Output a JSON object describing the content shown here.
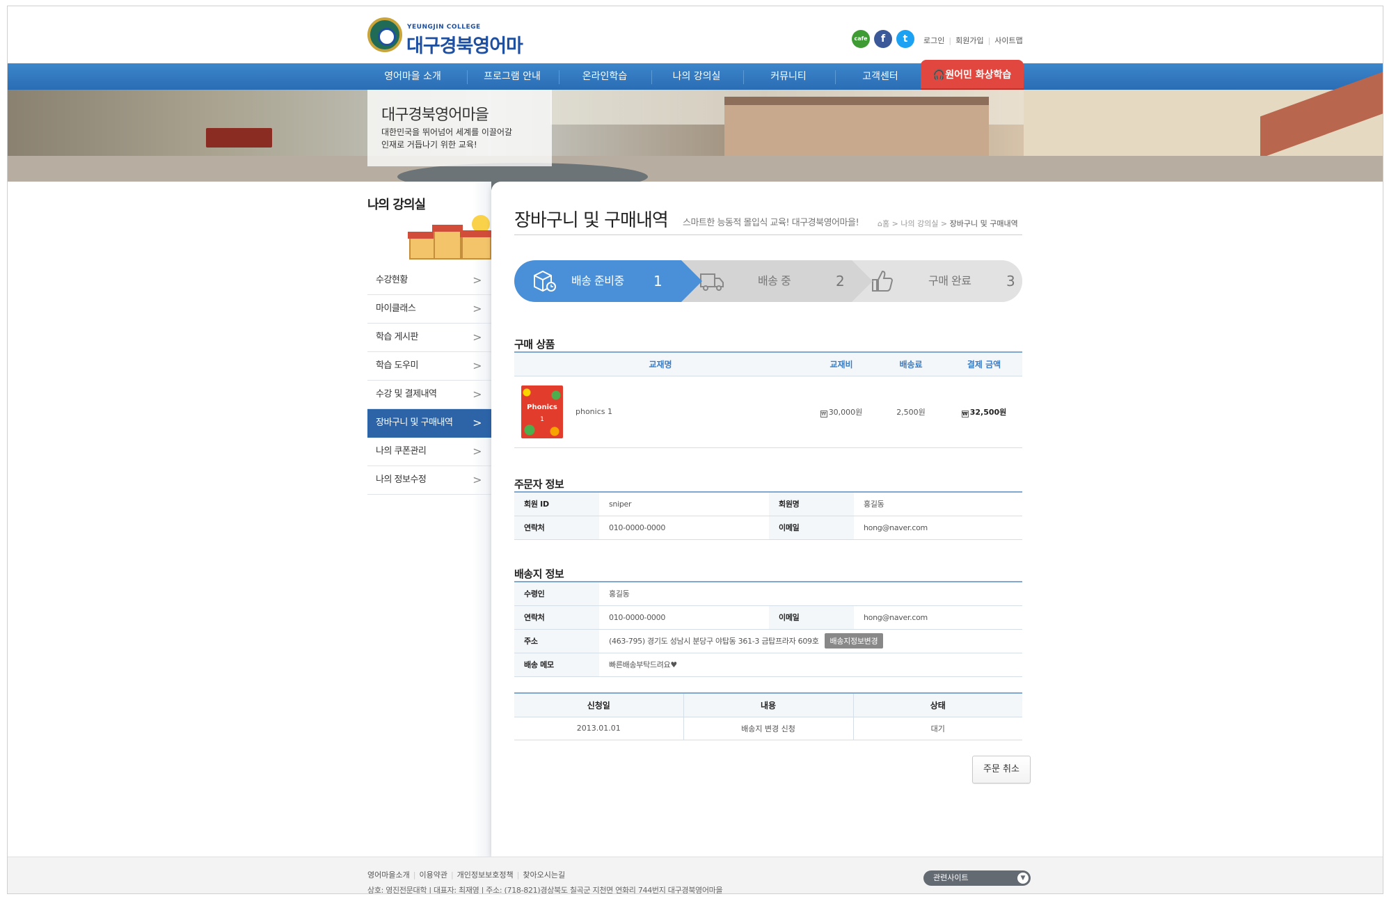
{
  "header": {
    "logo_sub": "YEUNGJIN COLLEGE",
    "logo_main": "대구경북영어마을",
    "social": {
      "cafe": "cafe",
      "facebook": "f",
      "twitter": "t"
    },
    "util_links": [
      "로그인",
      "회원가입",
      "사이트맵"
    ]
  },
  "nav": {
    "items": [
      "영어마을 소개",
      "프로그램 안내",
      "온라인학습",
      "나의 강의실",
      "커뮤니티",
      "고객센터"
    ],
    "special": "원어민 화상학습"
  },
  "banner": {
    "title": "대구경북영어마을",
    "desc_line1": "대한민국을 뛰어넘어 세계를 이끌어갈",
    "desc_line2": "인재로 거듭나기 위한 교육!"
  },
  "sidebar": {
    "title": "나의 강의실",
    "items": [
      {
        "label": "수강현황"
      },
      {
        "label": "마이클래스"
      },
      {
        "label": "학습 게시판"
      },
      {
        "label": "학습 도우미"
      },
      {
        "label": "수강 및 결제내역"
      },
      {
        "label": "장바구니 및 구매내역"
      },
      {
        "label": "나의 쿠폰관리"
      },
      {
        "label": "나의 정보수정"
      }
    ],
    "active_index": 5
  },
  "page": {
    "title": "장바구니 및 구매내역",
    "subtitle": "스마트한 능동적 몰입식 교육! 대구경북영어마을!",
    "breadcrumb": [
      "홈",
      "나의 강의실",
      "장바구니 및 구매내역"
    ]
  },
  "steps": [
    {
      "label": "배송 준비중",
      "num": "1",
      "icon": "box-clock-icon",
      "active": true
    },
    {
      "label": "배송 중",
      "num": "2",
      "icon": "truck-icon",
      "active": false
    },
    {
      "label": "구매 완료",
      "num": "3",
      "icon": "thumbs-up-icon",
      "active": false
    }
  ],
  "purchase": {
    "section_title": "구매 상품",
    "headers": [
      "교재명",
      "교재비",
      "배송료",
      "결제 금액"
    ],
    "row": {
      "book_cover_title": "Phonics",
      "book_cover_num": "1",
      "name": "phonics 1",
      "price": "30,000원",
      "shipping": "2,500원",
      "total": "32,500원"
    }
  },
  "orderer": {
    "section_title": "주문자 정보",
    "id_label": "회원 ID",
    "id_value": "sniper",
    "name_label": "회원명",
    "name_value": "홍길동",
    "phone_label": "연락처",
    "phone_value": "010-0000-0000",
    "email_label": "이메일",
    "email_value": "hong@naver.com"
  },
  "shipping": {
    "section_title": "배송지 정보",
    "recipient_label": "수령인",
    "recipient_value": "홍길동",
    "phone_label": "연락처",
    "phone_value": "010-0000-0000",
    "email_label": "이메일",
    "email_value": "hong@naver.com",
    "address_label": "주소",
    "address_value": "(463-795) 경기도 성남시 분당구 야탑동 361-3 금탑프라자 609호",
    "change_button": "배송지정보변경",
    "memo_label": "배송 메모",
    "memo_value": "빠른배송부탁드려요♥"
  },
  "requests": {
    "headers": [
      "신청일",
      "내용",
      "상태"
    ],
    "rows": [
      {
        "date": "2013.01.01",
        "content": "배송지 변경 신청",
        "status": "대기"
      }
    ]
  },
  "cancel_button": "주문 취소",
  "footer": {
    "links": [
      "영어마을소개",
      "이용약관",
      "개인정보보호정책",
      "찾아오시는길"
    ],
    "address": "상호: 영진전문대학 | 대표자: 최재영 | 주소: (718-821)경상북도 칠곡군 지천면 연화리 744번지 대구경북영어마을",
    "related_sites": "관련사이트"
  },
  "colors": {
    "primary": "#2d64a8",
    "step_active": "#4a90d9",
    "accent": "#e1473f"
  }
}
